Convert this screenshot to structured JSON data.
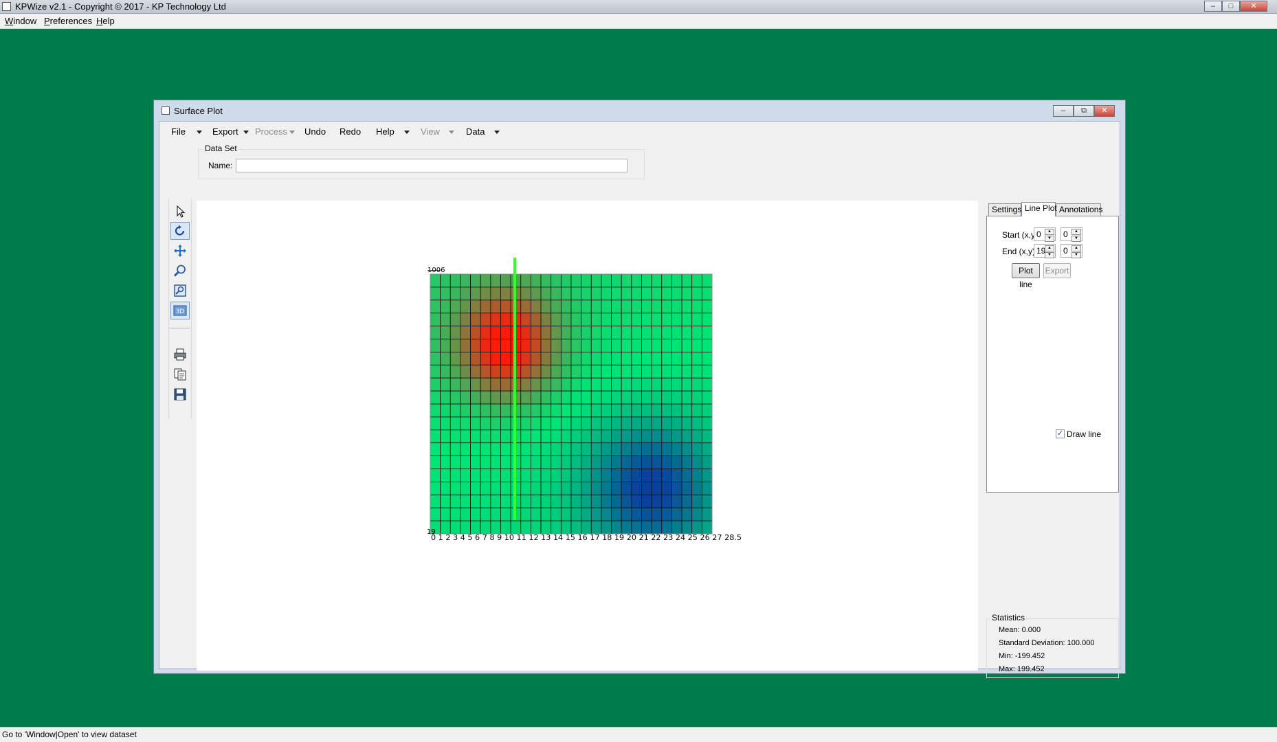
{
  "app": {
    "title": "KPWize v2.1 - Copyright © 2017 - KP Technology Ltd",
    "menu": [
      "Window",
      "Preferences",
      "Help"
    ],
    "status": "Go to 'Window|Open' to view dataset"
  },
  "window": {
    "title": "Surface Plot",
    "menu": [
      {
        "label": "File",
        "caret": true,
        "disabled": false
      },
      {
        "label": "Export",
        "caret": true,
        "disabled": false
      },
      {
        "label": "Process",
        "caret": true,
        "disabled": true
      },
      {
        "label": "Undo",
        "caret": false,
        "disabled": false
      },
      {
        "label": "Redo",
        "caret": false,
        "disabled": false
      },
      {
        "label": "Help",
        "caret": true,
        "disabled": false
      },
      {
        "label": "View",
        "caret": true,
        "disabled": true
      },
      {
        "label": "Data",
        "caret": true,
        "disabled": false
      }
    ]
  },
  "dataset": {
    "legend": "Data Set",
    "name_label": "Name:",
    "name_value": ""
  },
  "toolbar": {
    "icons": [
      "pointer-icon",
      "rotate-icon",
      "pan-icon",
      "zoom-icon",
      "zoom-box-icon",
      "3d-view-icon",
      "print-icon",
      "copy-icon",
      "save-icon"
    ],
    "active": [
      "rotate-icon",
      "3d-view-icon"
    ]
  },
  "plot": {
    "grid_cols": 28,
    "grid_rows": 20,
    "line_plot_column": 8.4,
    "line_color": "#33ff33",
    "corner_label_bottom": "19",
    "x_axis_text": "0 1 2 3 4 5 6 7 8 9 10 11 12 13 14 15 16 17 18 19 20 21 22 23 24 25 26 27 28.5",
    "color_low": "#0a3f9e",
    "color_mid": "#00e676",
    "color_high": "#ff1a0a"
  },
  "tabs": {
    "items": [
      "Settings",
      "Line Plot",
      "Annotations"
    ],
    "active": "Line Plot"
  },
  "line_plot": {
    "start_label": "Start (x,y):",
    "start_x": "0",
    "start_y": "0",
    "end_label": "End (x,y):",
    "end_x": "19",
    "end_y": "0",
    "plot_button": "Plot line",
    "export_button": "Export",
    "draw_line_label": "Draw line",
    "draw_line_checked": true
  },
  "statistics": {
    "legend": "Statistics",
    "mean": "Mean: 0.000",
    "std": "Standard Deviation: 100.000",
    "min": "Min: -199.452",
    "max": "Max: 199.452"
  }
}
